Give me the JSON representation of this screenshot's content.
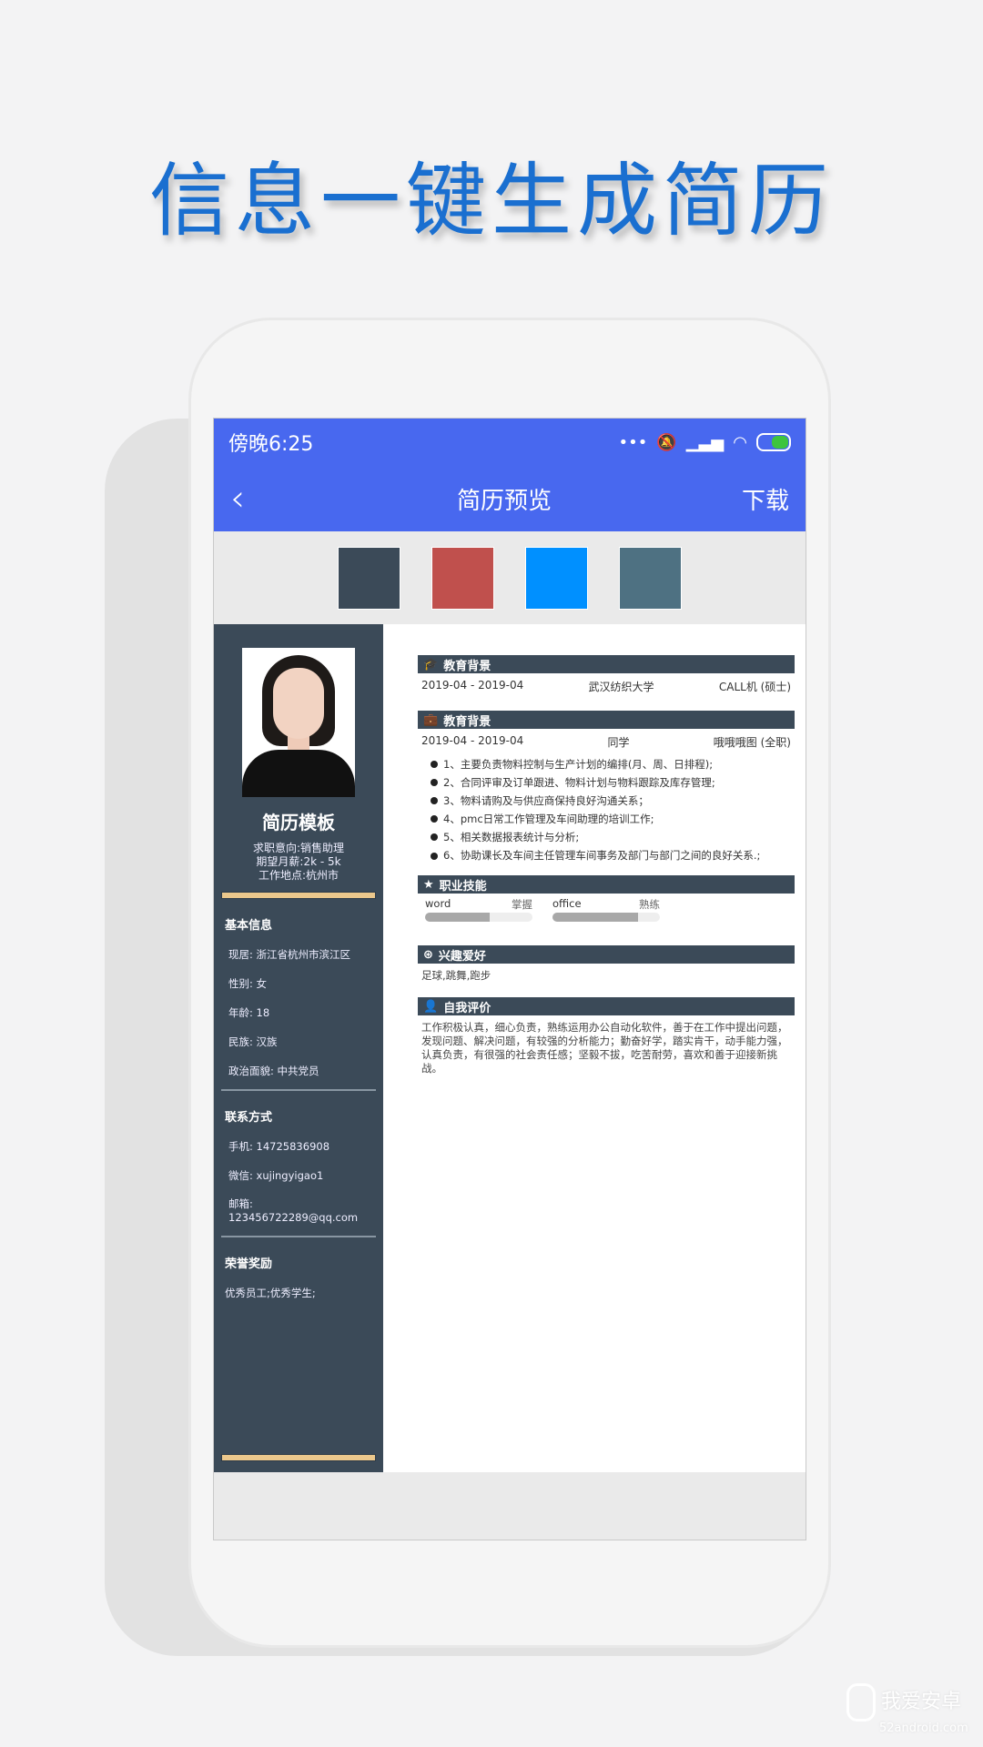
{
  "headline": "信息一键生成简历",
  "status_bar": {
    "time": "傍晚6:25",
    "icons": [
      "more-dots-icon",
      "mute-bell-icon",
      "signal-icon",
      "wifi-icon",
      "battery-charging-icon"
    ],
    "dots": "•••"
  },
  "nav": {
    "back_icon": "‹",
    "title": "简历预览",
    "download_label": "下载"
  },
  "swatches": [
    {
      "name": "dark-slate",
      "color": "#3b4a58"
    },
    {
      "name": "red",
      "color": "#c0504d"
    },
    {
      "name": "blue",
      "color": "#0090ff"
    },
    {
      "name": "slate-teal",
      "color": "#4e7182"
    }
  ],
  "resume": {
    "sidebar": {
      "name": "简历模板",
      "job_intent": "求职意向:销售助理",
      "salary": "期望月薪:2k - 5k",
      "location": "工作地点:杭州市",
      "basic_info": {
        "title": "基本信息",
        "items": [
          "现居: 浙江省杭州市滨江区",
          "性别: 女",
          "年龄: 18",
          "民族: 汉族",
          "政治面貌: 中共党员"
        ]
      },
      "contact": {
        "title": "联系方式",
        "items": [
          "手机: 14725836908",
          "微信: xujingyigao1",
          "邮箱: 123456722289@qq.com"
        ]
      },
      "honors": {
        "title": "荣誉奖励",
        "text": "优秀员工;优秀学生;"
      }
    },
    "education": {
      "title": "教育背景",
      "icon": "graduation-cap-icon",
      "period": "2019-04 - 2019-04",
      "school": "武汉纺织大学",
      "degree": "CALL机 (硕士)"
    },
    "work": {
      "title": "教育背景",
      "icon": "briefcase-icon",
      "period": "2019-04 - 2019-04",
      "company": "同学",
      "position": "哦哦哦图 (全职)",
      "duties": [
        "1、主要负责物料控制与生产计划的编排(月、周、日排程);",
        "2、合同评审及订单跟进、物料计划与物料跟踪及库存管理;",
        "3、物料请购及与供应商保持良好沟通关系；",
        "4、pmc日常工作管理及车间助理的培训工作;",
        "5、相关数据报表统计与分析;",
        "6、协助课长及车间主任管理车间事务及部门与部门之间的良好关系.;"
      ]
    },
    "skills": {
      "title": "职业技能",
      "icon": "skill-badge-icon",
      "items": [
        {
          "name": "word",
          "level": "掌握",
          "progress": 0.6
        },
        {
          "name": "office",
          "level": "熟练",
          "progress": 0.8
        }
      ]
    },
    "hobbies": {
      "title": "兴趣爱好",
      "icon": "basketball-icon",
      "text": "足球,跳舞,跑步"
    },
    "self_eval": {
      "title": "自我评价",
      "icon": "user-edit-icon",
      "text": "工作积极认真，细心负责，熟练运用办公自动化软件，善于在工作中提出问题，发现问题、解决问题，有较强的分析能力；勤奋好学，踏实肯干，动手能力强，认真负责，有很强的社会责任感；坚毅不拔，吃苦耐劳，喜欢和善于迎接新挑战。"
    }
  },
  "watermark": {
    "title": "我爱安卓",
    "subtitle": "52android.com"
  }
}
